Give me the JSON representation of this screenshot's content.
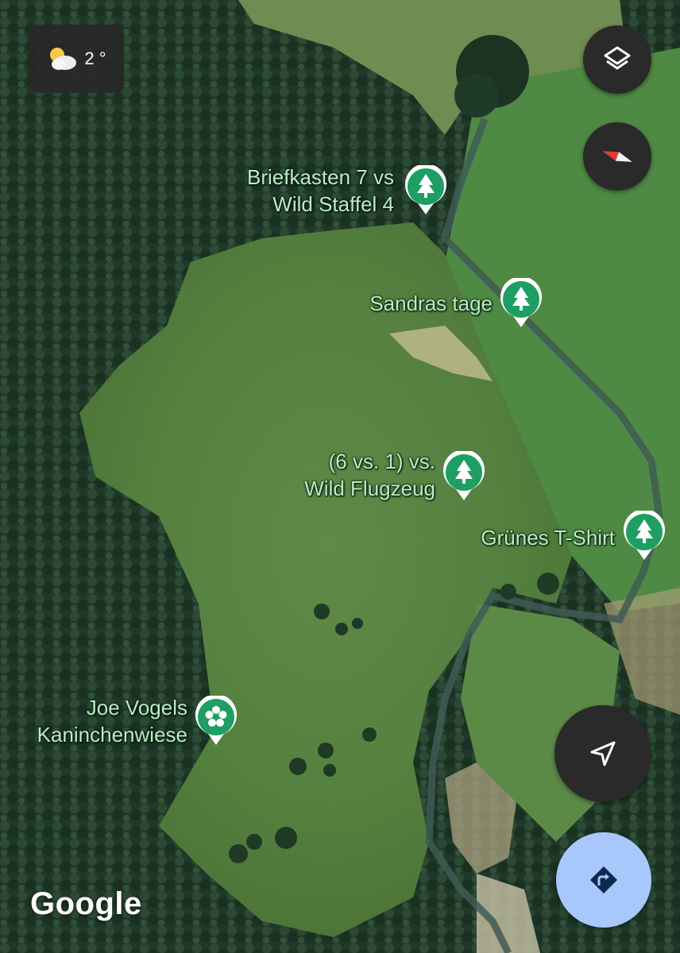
{
  "weather": {
    "temperature": "2 °",
    "icon": "partly-cloudy-icon"
  },
  "controls": {
    "layers_icon": "layers-icon",
    "compass_icon": "compass-icon",
    "location_icon": "navigation-arrow-icon",
    "directions_icon": "directions-icon"
  },
  "places": [
    {
      "line1": "Briefkasten 7 vs",
      "line2": "Wild Staffel 4",
      "icon": "tree-icon"
    },
    {
      "line1": "Sandras tage",
      "line2": "",
      "icon": "tree-icon"
    },
    {
      "line1": "(6 vs. 1) vs.",
      "line2": "Wild Flugzeug",
      "icon": "tree-icon"
    },
    {
      "line1": "Grünes T-Shirt",
      "line2": "",
      "icon": "tree-icon"
    },
    {
      "line1": "Joe Vogels",
      "line2": "Kaninchenwiese",
      "icon": "flower-icon"
    }
  ],
  "attribution": "Google",
  "colors": {
    "forest": "#1f3a24",
    "meadow": "#4e7a3e",
    "pin": "#1e9e62",
    "label": "#b9eec4",
    "directions_button": "#a8c7fa"
  }
}
